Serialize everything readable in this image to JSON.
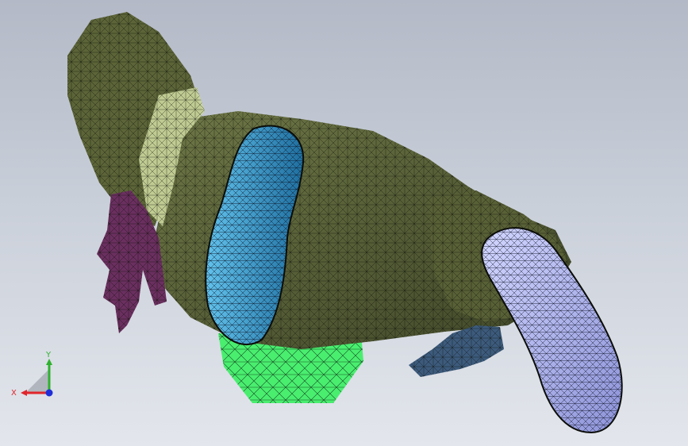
{
  "viewport": {
    "background_top": "#b3b9c6",
    "background_bottom": "#e3e6ec",
    "mesh_line_color": "#0b0d08",
    "parts": [
      {
        "name": "body",
        "color": "#5a6237"
      },
      {
        "name": "left-arm-inner",
        "color": "#c8d49a"
      },
      {
        "name": "left-hand",
        "color": "#6a2f5f"
      },
      {
        "name": "left-foot-sole",
        "color": "#3a94c3"
      },
      {
        "name": "right-foot-sole",
        "color": "#aab0ec"
      },
      {
        "name": "right-hand",
        "color": "#3c5a7c"
      },
      {
        "name": "base-block",
        "color": "#49ee6f"
      }
    ]
  },
  "triad": {
    "x_label": "X",
    "y_label": "Y",
    "x_color": "#e0262c",
    "y_color": "#2fb12f",
    "z_color": "#1f2ed6"
  }
}
